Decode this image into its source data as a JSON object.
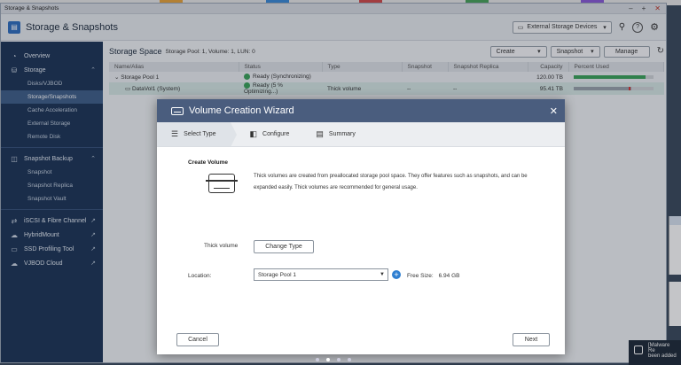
{
  "window": {
    "title": "Storage & Snapshots"
  },
  "app": {
    "title": "Storage & Snapshots",
    "external_devices_label": "External Storage Devices"
  },
  "sidebar": {
    "items": [
      {
        "label": "Overview",
        "icon": "dashboard-icon"
      },
      {
        "label": "Storage",
        "icon": "database-icon"
      },
      {
        "label": "Snapshot Backup",
        "icon": "snapshot-icon"
      },
      {
        "label": "iSCSI & Fibre Channel",
        "icon": "network-icon"
      },
      {
        "label": "HybridMount",
        "icon": "cloud-icon"
      },
      {
        "label": "SSD Profiling Tool",
        "icon": "ssd-icon"
      },
      {
        "label": "VJBOD Cloud",
        "icon": "cloud-icon"
      }
    ],
    "storage_sub": [
      "Disks/VJBOD",
      "Storage/Snapshots",
      "Cache Acceleration",
      "External Storage",
      "Remote Disk"
    ],
    "snapshot_sub": [
      "Snapshot",
      "Snapshot Replica",
      "Snapshot Vault"
    ]
  },
  "storage_space": {
    "title": "Storage Space",
    "info": "Storage Pool: 1, Volume: 1, LUN: 0",
    "buttons": {
      "create": "Create",
      "snapshot": "Snapshot",
      "manage": "Manage"
    },
    "columns": [
      "Name/Alias",
      "Status",
      "Type",
      "Snapshot",
      "Snapshot Replica",
      "Capacity",
      "Percent Used"
    ],
    "rows": [
      {
        "name": "Storage Pool 1",
        "status": "Ready (Synchronizing)",
        "type": "",
        "snapshot": "",
        "replica": "",
        "capacity": "120.00 TB",
        "used_fraction": 0.9
      },
      {
        "name": "DataVol1 (System)",
        "status": "Ready (5 % Optimizing...)",
        "type": "Thick volume",
        "snapshot": "--",
        "replica": "--",
        "capacity": "95.41 TB",
        "used_fraction": 0.72
      }
    ]
  },
  "wizard": {
    "title": "Volume Creation Wizard",
    "steps": [
      "Select Type",
      "Configure",
      "Summary"
    ],
    "create_volume_label": "Create Volume",
    "description": "Thick volumes are created from preallocated storage pool space. They offer features such as snapshots, and can be expanded easily. Thick volumes are recommended for general usage.",
    "volume_type": "Thick volume",
    "change_type_label": "Change Type",
    "location_label": "Location:",
    "location_value": "Storage Pool 1",
    "free_size_label": "Free Size:",
    "free_size_value": "6.94 GB",
    "cancel_label": "Cancel",
    "next_label": "Next"
  },
  "toast": {
    "line1": "[Malware Re",
    "line2": "been added"
  }
}
